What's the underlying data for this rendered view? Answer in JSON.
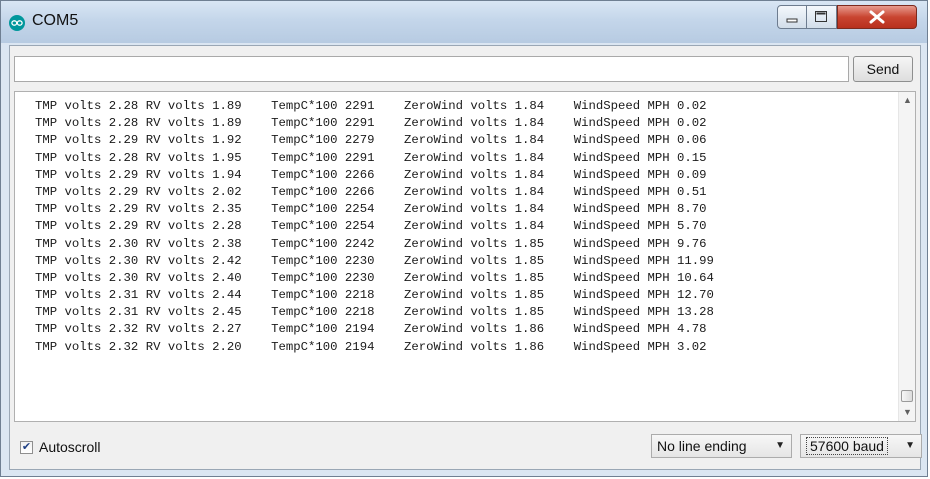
{
  "window": {
    "title": "COM5",
    "icon": "arduino-icon",
    "controls": {
      "minimize_icon": "minimize-icon",
      "maximize_icon": "maximize-icon",
      "close_icon": "close-icon"
    }
  },
  "input": {
    "value": ""
  },
  "send_button": {
    "label": "Send"
  },
  "output": {
    "lines": [
      "TMP volts 2.28 RV volts 1.89    TempC*100 2291    ZeroWind volts 1.84    WindSpeed MPH 0.02",
      "TMP volts 2.28 RV volts 1.89    TempC*100 2291    ZeroWind volts 1.84    WindSpeed MPH 0.02",
      "TMP volts 2.29 RV volts 1.92    TempC*100 2279    ZeroWind volts 1.84    WindSpeed MPH 0.06",
      "TMP volts 2.28 RV volts 1.95    TempC*100 2291    ZeroWind volts 1.84    WindSpeed MPH 0.15",
      "TMP volts 2.29 RV volts 1.94    TempC*100 2266    ZeroWind volts 1.84    WindSpeed MPH 0.09",
      "TMP volts 2.29 RV volts 2.02    TempC*100 2266    ZeroWind volts 1.84    WindSpeed MPH 0.51",
      "TMP volts 2.29 RV volts 2.35    TempC*100 2254    ZeroWind volts 1.84    WindSpeed MPH 8.70",
      "TMP volts 2.29 RV volts 2.28    TempC*100 2254    ZeroWind volts 1.84    WindSpeed MPH 5.70",
      "TMP volts 2.30 RV volts 2.38    TempC*100 2242    ZeroWind volts 1.85    WindSpeed MPH 9.76",
      "TMP volts 2.30 RV volts 2.42    TempC*100 2230    ZeroWind volts 1.85    WindSpeed MPH 11.99",
      "TMP volts 2.30 RV volts 2.40    TempC*100 2230    ZeroWind volts 1.85    WindSpeed MPH 10.64",
      "TMP volts 2.31 RV volts 2.44    TempC*100 2218    ZeroWind volts 1.85    WindSpeed MPH 12.70",
      "TMP volts 2.31 RV volts 2.45    TempC*100 2218    ZeroWind volts 1.85    WindSpeed MPH 13.28",
      "TMP volts 2.32 RV volts 2.27    TempC*100 2194    ZeroWind volts 1.86    WindSpeed MPH 4.78",
      "TMP volts 2.32 RV volts 2.20    TempC*100 2194    ZeroWind volts 1.86    WindSpeed MPH 3.02"
    ]
  },
  "footer": {
    "autoscroll": {
      "label": "Autoscroll",
      "checked": true
    },
    "line_ending": {
      "selected": "No line ending"
    },
    "baud_rate": {
      "selected": "57600 baud"
    }
  },
  "colors": {
    "title_bar": "#c4d6ea",
    "close_button": "#c94531",
    "icon_teal": "#00979c"
  }
}
